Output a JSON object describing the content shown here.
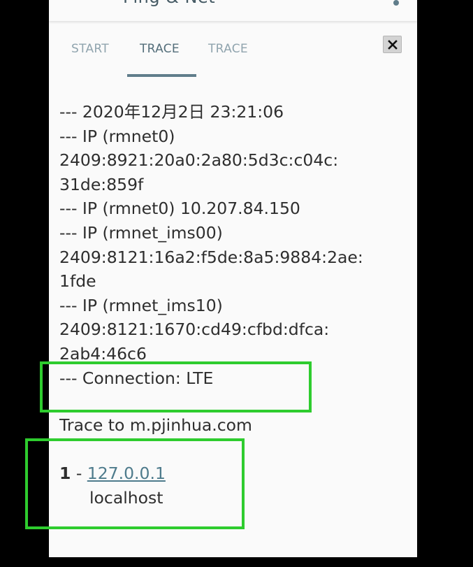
{
  "app": {
    "title": "Ping & Net"
  },
  "tabs": [
    {
      "label": "START"
    },
    {
      "label": "TRACE"
    },
    {
      "label": "TRACE"
    }
  ],
  "close_label": "×",
  "log_lines": [
    "--- 2020年12月2日 23:21:06",
    "--- IP (rmnet0)",
    "2409:8921:20a0:2a80:5d3c:c04c:",
    "31de:859f",
    "--- IP (rmnet0) 10.207.84.150",
    "--- IP (rmnet_ims00)",
    "2409:8121:16a2:f5de:8a5:9884:2ae:",
    "1fde",
    "--- IP (rmnet_ims10)",
    "2409:8121:1670:cd49:cfbd:dfca:",
    "2ab4:46c6",
    "--- Connection: LTE"
  ],
  "trace": {
    "title": "Trace to m.pjinhua.com",
    "hops": [
      {
        "num": "1",
        "sep": " - ",
        "ip": "127.0.0.1",
        "host": "localhost"
      }
    ]
  },
  "colors": {
    "highlight": "#2ecc2e",
    "tab_indicator": "#607d8b",
    "link": "#4e7b8c"
  }
}
